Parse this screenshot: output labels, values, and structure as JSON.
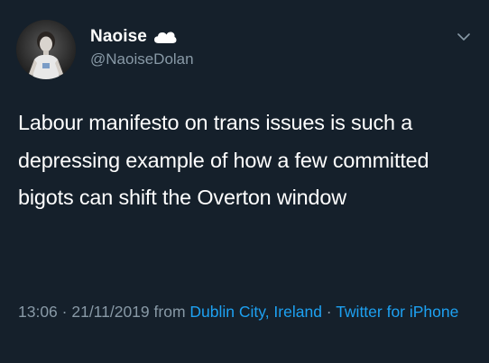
{
  "author": {
    "display_name": "Naoise",
    "handle": "@NaoiseDolan",
    "badge_icon": "cloud-icon"
  },
  "tweet": {
    "text": "Labour manifesto on trans issues is such a depressing example of how a few committed bigots can shift the Overton window"
  },
  "meta": {
    "time": "13:06",
    "separator_1": " · ",
    "date": "21/11/2019",
    "from_label": " from ",
    "location": "Dublin City, Ireland",
    "separator_2": " · ",
    "source": "Twitter for iPhone"
  },
  "colors": {
    "background": "#15202b",
    "secondary_text": "#8899a6",
    "link": "#1da1f2"
  },
  "icons": {
    "menu": "chevron-down-icon"
  }
}
